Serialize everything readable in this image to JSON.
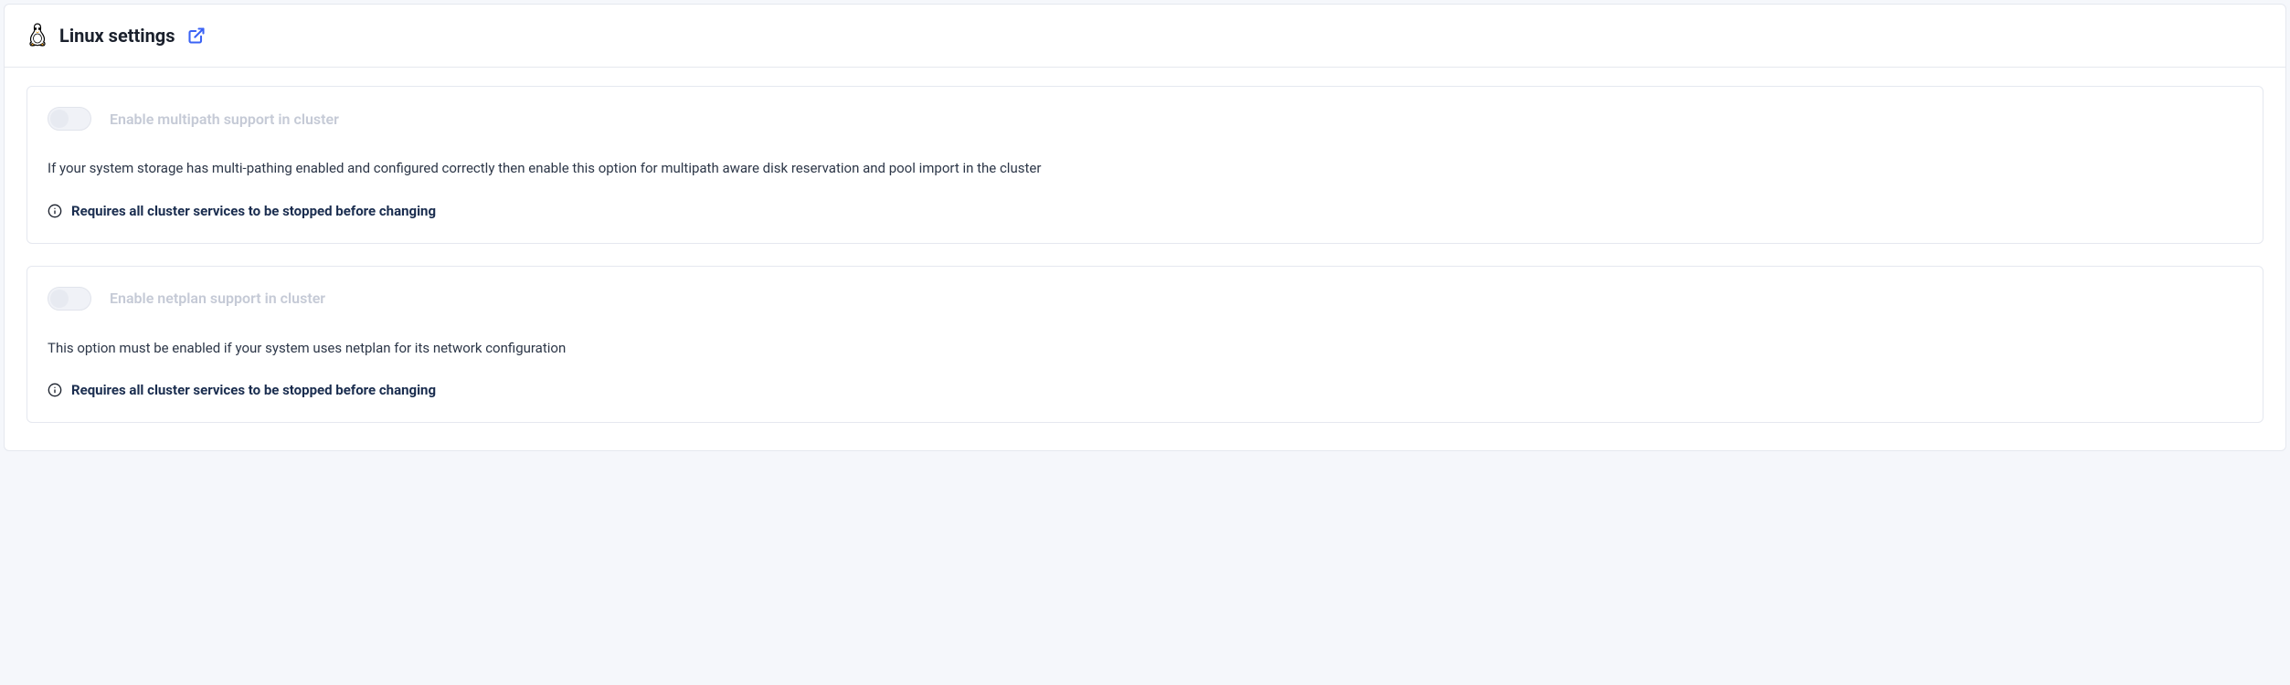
{
  "header": {
    "title": "Linux settings"
  },
  "settings": {
    "multipath": {
      "label": "Enable multipath support in cluster",
      "description": "If your system storage has multi-pathing enabled and configured correctly then enable this option for multipath aware disk reservation and pool import in the cluster",
      "warning": "Requires all cluster services to be stopped before changing"
    },
    "netplan": {
      "label": "Enable netplan support in cluster",
      "description": "This option must be enabled if your system uses netplan for its network configuration",
      "warning": "Requires all cluster services to be stopped before changing"
    }
  }
}
